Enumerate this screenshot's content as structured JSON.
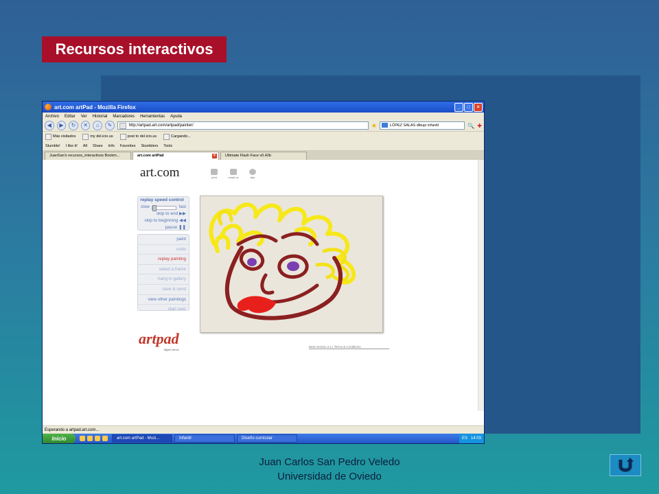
{
  "slide": {
    "title": "Recursos interactivos",
    "author": "Juan Carlos San Pedro Veledo",
    "institution": "Universidad de Oviedo",
    "home_icon": "u-turn-icon"
  },
  "browser": {
    "window_title": "art.com artPad - Mozilla Firefox",
    "menu": [
      "Archivo",
      "Editar",
      "Ver",
      "Historial",
      "Marcadores",
      "Herramientas",
      "Ayuda"
    ],
    "url": "http://artpad.art.com/artpad/painter/",
    "search_value": "LÓPEZ SALAS dibujo infantil",
    "bookmarks": [
      "Más visitados",
      "my del.icio.us",
      "post to del.icio.us",
      "Cargando..."
    ],
    "stumble_toolbar": [
      "Stumble!",
      "I like it!",
      "All",
      "Share",
      "Info",
      "Favorites",
      "Stumblers",
      "Tools"
    ],
    "tabs": [
      {
        "label": "JuanSan's recursos_interactivos Bookm...",
        "active": false
      },
      {
        "label": "art.com artPad",
        "active": true
      },
      {
        "label": "Ultimate Flash Face v0.42b",
        "active": false
      }
    ],
    "status": "Esperando a artpad.art.com..."
  },
  "artpad": {
    "brand": "art.com",
    "tools": [
      "print",
      "email us",
      "tips"
    ],
    "replay": {
      "heading": "replay speed control",
      "slow": "slow",
      "fast": "fast",
      "skip_end": "skip to end",
      "skip_begin": "skip to beginning",
      "pause": "pause"
    },
    "menu": [
      {
        "label": "paint",
        "state": "normal"
      },
      {
        "label": "undo",
        "state": "disabled"
      },
      {
        "label": "replay painting",
        "state": "active"
      },
      {
        "label": "select a frame",
        "state": "disabled"
      },
      {
        "label": "hang in gallery",
        "state": "disabled"
      },
      {
        "label": "save & send",
        "state": "disabled"
      },
      {
        "label": "view other paintings",
        "state": "normal"
      },
      {
        "label": "start over",
        "state": "disabled"
      }
    ],
    "logo_text": "artpad",
    "logo_tagline": "digital canvas",
    "footer": "Beta Version 2.1  |  Terms & Conditions"
  },
  "taskbar": {
    "start": "Inicio",
    "items": [
      "art.com artPad - Mozi...",
      "Infantil",
      "Diseño curricular"
    ],
    "lang": "ES",
    "clock": "14:03"
  },
  "colors": {
    "title_bg": "#a8102a",
    "paint_yellow": "#f7e81a",
    "paint_brown": "#8b2020",
    "paint_purple": "#7a3fb0",
    "paint_red": "#e8201c"
  }
}
